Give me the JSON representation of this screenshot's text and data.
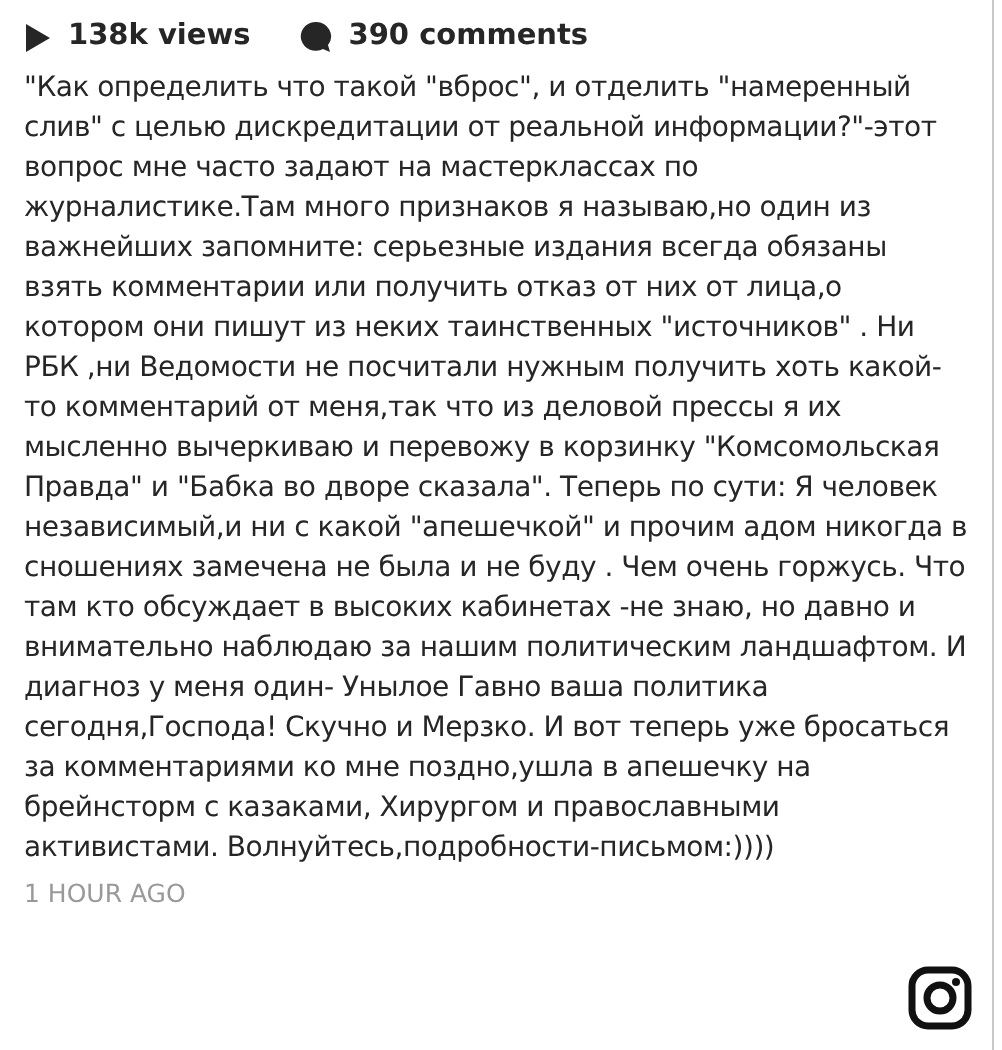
{
  "stats": {
    "views": "138k views",
    "comments": "390 comments"
  },
  "caption": "\"Как определить что такой \"вброс\", и отделить \"намеренный слив\" с целью дискредитации от реальной информации?\"-этот вопрос мне часто задают на мастерклассах по журналистике.Там много признаков я называю,но один из важнейших запомните: серьезные издания всегда обязаны взять комментарии или получить отказ от них от лица,о котором они пишут из неких таинственных \"источников\" . Ни РБК ,ни Ведомости не посчитали нужным получить хоть какой-то комментарий от меня,так что из деловой прессы я их мысленно вычеркиваю и перевожу в корзинку \"Комсомольская Правда\" и \"Бабка во дворе сказала\". Теперь по сути: Я человек независимый,и ни с какой \"апешечкой\" и прочим адом никогда в сношениях замечена не была и не буду . Чем очень горжусь. Что там кто обсуждает в высоких кабинетах -не знаю, но давно и внимательно наблюдаю за нашим политическим ландшафтом. И диагноз у меня один- Унылое Гавно ваша политика сегодня,Господа! Скучно и Мерзко. И вот теперь уже бросаться за комментариями ко мне поздно,ушла в апешечку на брейнсторм с казаками, Хирургом и православными активистами. Волнуйтесь,подробности-письмом:))))",
  "timestamp": "1 HOUR AGO"
}
